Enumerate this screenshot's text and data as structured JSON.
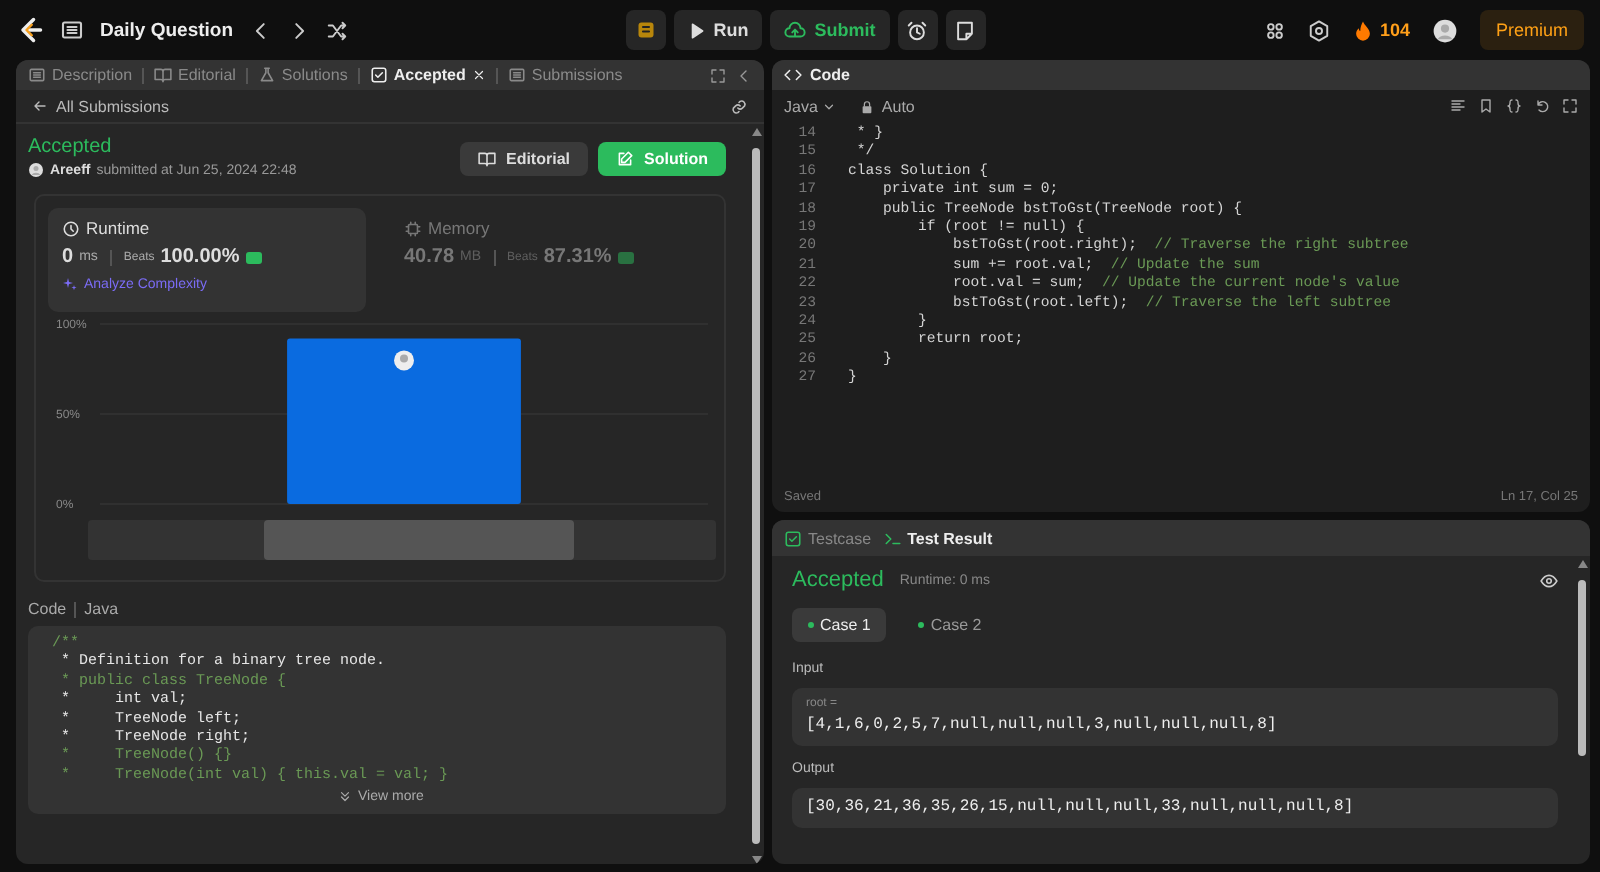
{
  "topbar": {
    "title": "Daily Question",
    "run": "Run",
    "submit": "Submit",
    "streak": "104",
    "premium": "Premium"
  },
  "left_panel": {
    "tabs": [
      {
        "label": "Description",
        "selected": false
      },
      {
        "label": "Editorial",
        "selected": false
      },
      {
        "label": "Solutions",
        "selected": false
      },
      {
        "label": "Accepted",
        "selected": true
      },
      {
        "label": "Submissions",
        "selected": false
      }
    ],
    "back_link": "All Submissions",
    "status": "Accepted",
    "user": "Areeff",
    "submitted": "submitted at Jun 25, 2024 22:48",
    "buttons": [
      {
        "label": "Editorial",
        "kind": "secondary"
      },
      {
        "label": "Solution",
        "kind": "primary"
      }
    ],
    "stats": [
      {
        "title": "Runtime",
        "value": "0",
        "unit": "ms",
        "beats_label": "Beats",
        "beats": "100.00%",
        "selected": true,
        "link": "Analyze Complexity"
      },
      {
        "title": "Memory",
        "value": "40.78",
        "unit": "MB",
        "beats_label": "Beats",
        "beats": "87.31%",
        "selected": false
      }
    ],
    "chart_data": {
      "type": "bar",
      "values": [
        92
      ],
      "ylim": [
        0,
        100
      ],
      "yticks": [
        {
          "value": 0,
          "label": "0%"
        },
        {
          "value": 50,
          "label": "50%"
        },
        {
          "value": 100,
          "label": "100%"
        }
      ]
    },
    "code_label": "Code",
    "language": "Java",
    "code_lines": [
      {
        "text": "/**",
        "kind": "comment"
      },
      {
        "text": " * Definition for a binary tree node.",
        "kind": "plain"
      },
      {
        "text": " * public class TreeNode {",
        "kind": "comment"
      },
      {
        "text": " *     int val;",
        "kind": "plain"
      },
      {
        "text": " *     TreeNode left;",
        "kind": "plain"
      },
      {
        "text": " *     TreeNode right;",
        "kind": "plain"
      },
      {
        "text": " *     TreeNode() {}",
        "kind": "comment"
      },
      {
        "text": " *     TreeNode(int val) { this.val = val; }",
        "kind": "comment"
      }
    ],
    "view_more": "View more"
  },
  "code_panel": {
    "title": "Code",
    "language": "Java",
    "mode": "Auto",
    "lines": [
      {
        "number": "14",
        "code": " * }"
      },
      {
        "number": "15",
        "code": " */"
      },
      {
        "number": "16",
        "code": "class Solution {"
      },
      {
        "number": "17",
        "code": "    private int sum = 0;"
      },
      {
        "number": "18",
        "code": "    public TreeNode bstToGst(TreeNode root) {"
      },
      {
        "number": "19",
        "code": "        if (root != null) {"
      },
      {
        "number": "20",
        "code": "            bstToGst(root.right);  ",
        "comment": "// Traverse the right subtree"
      },
      {
        "number": "21",
        "code": "            sum += root.val;  ",
        "comment": "// Update the sum"
      },
      {
        "number": "22",
        "code": "            root.val = sum;  ",
        "comment": "// Update the current node's value"
      },
      {
        "number": "23",
        "code": "            bstToGst(root.left);  ",
        "comment": "// Traverse the left subtree"
      },
      {
        "number": "24",
        "code": "        }"
      },
      {
        "number": "25",
        "code": "        return root;"
      },
      {
        "number": "26",
        "code": "    }"
      },
      {
        "number": "27",
        "code": "}"
      }
    ],
    "saved": "Saved",
    "cursor": "Ln 17, Col 25"
  },
  "result_panel": {
    "tabs": [
      {
        "label": "Testcase",
        "selected": false
      },
      {
        "label": "Test Result",
        "selected": true
      }
    ],
    "status": "Accepted",
    "runtime": "Runtime: 0 ms",
    "cases": [
      {
        "label": "Case 1",
        "selected": true
      },
      {
        "label": "Case 2",
        "selected": false
      }
    ],
    "input_label": "Input",
    "input_name": "root =",
    "input_value": "[4,1,6,0,2,5,7,null,null,null,3,null,null,null,8]",
    "output_label": "Output",
    "output_value": "[30,36,21,36,35,26,15,null,null,null,33,null,null,null,8]"
  }
}
